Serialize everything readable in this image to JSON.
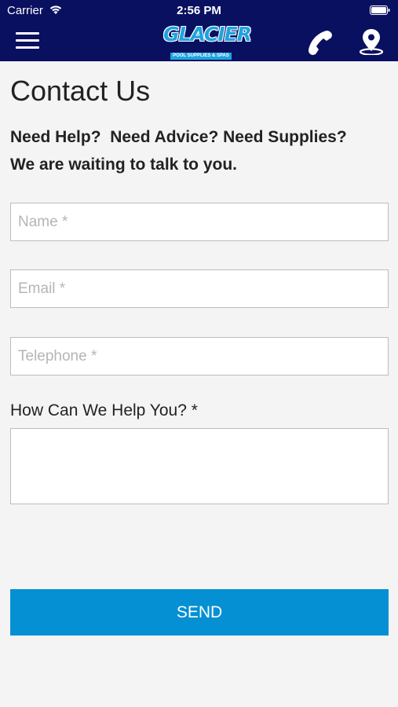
{
  "status_bar": {
    "carrier": "Carrier",
    "time": "2:56 PM"
  },
  "header": {
    "logo_text": "GLACIER",
    "logo_subtext": "POOL SUPPLIES & SPAS",
    "background_color": "#0a1060",
    "icons": [
      "menu-icon",
      "phone-icon",
      "location-pin-icon"
    ]
  },
  "page": {
    "title": "Contact Us",
    "subtitle_line1": "Need Help?  Need Advice? Need Supplies?",
    "subtitle_line2": "We are waiting to talk to you."
  },
  "form": {
    "name_placeholder": "Name *",
    "email_placeholder": "Email *",
    "telephone_placeholder": "Telephone *",
    "name_value": "",
    "email_value": "",
    "telephone_value": "",
    "message_label": "How Can We Help You? *",
    "message_value": "",
    "send_label": "SEND",
    "send_color": "#0490d3"
  }
}
